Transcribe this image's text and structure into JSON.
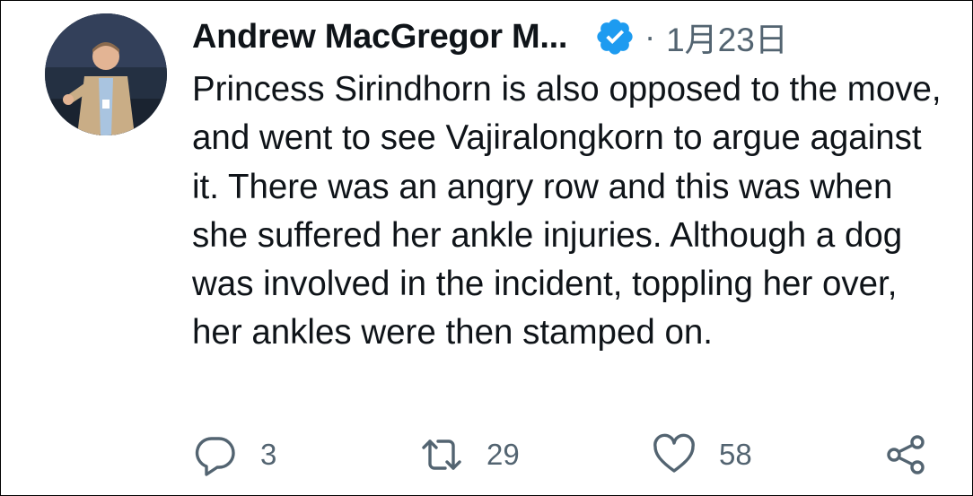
{
  "author": {
    "display_name": "Andrew MacGregor M...",
    "verified_icon": "verified-badge-icon",
    "avatar": "avatar-photo"
  },
  "meta": {
    "separator": "·",
    "date": "1月23日"
  },
  "tweet": {
    "text": "Princess Sirindhorn is also opposed to the move, and went to see Vajiralongkorn to argue against it. There was an angry row and this was when she suffered her ankle injuries. Although a dog was involved in the incident, toppling her over, her ankles were then stamped on."
  },
  "actions": {
    "reply": {
      "icon": "reply-icon",
      "count": "3"
    },
    "retweet": {
      "icon": "retweet-icon",
      "count": "29"
    },
    "like": {
      "icon": "heart-icon",
      "count": "58"
    },
    "share": {
      "icon": "share-icon"
    }
  },
  "colors": {
    "text": "#0f1419",
    "secondary": "#536471",
    "verified": "#1d9bf0"
  }
}
